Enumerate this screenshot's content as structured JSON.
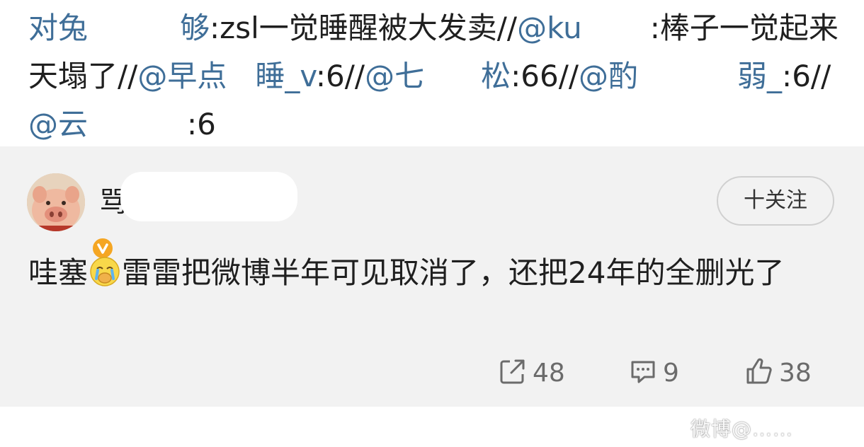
{
  "repost": {
    "seg1": "对兔",
    "seg2": "够",
    "seg3": ":zsl一觉睡醒被大发卖//",
    "seg4": "@ku",
    "seg5": ":棒子一觉起来天塌了//",
    "seg6": "@早点",
    "seg7": "睡_v",
    "seg8": ":6//",
    "seg9": "@七",
    "seg10": "松",
    "seg11": ":66//",
    "seg12": "@酌",
    "seg13": "弱_",
    "seg14": ":6//",
    "seg15": "@云",
    "seg16": ":6"
  },
  "comment": {
    "username": "骂",
    "follow_label": "十关注",
    "text_before_emoji": "哇塞",
    "text_after_emoji": "雷雷把微博半年可见取消了，还把24年的全删光了",
    "emoji_name": "crying-face-icon",
    "repost_count": "48",
    "comment_count": "9",
    "like_count": "38"
  },
  "watermark": "微博@……"
}
